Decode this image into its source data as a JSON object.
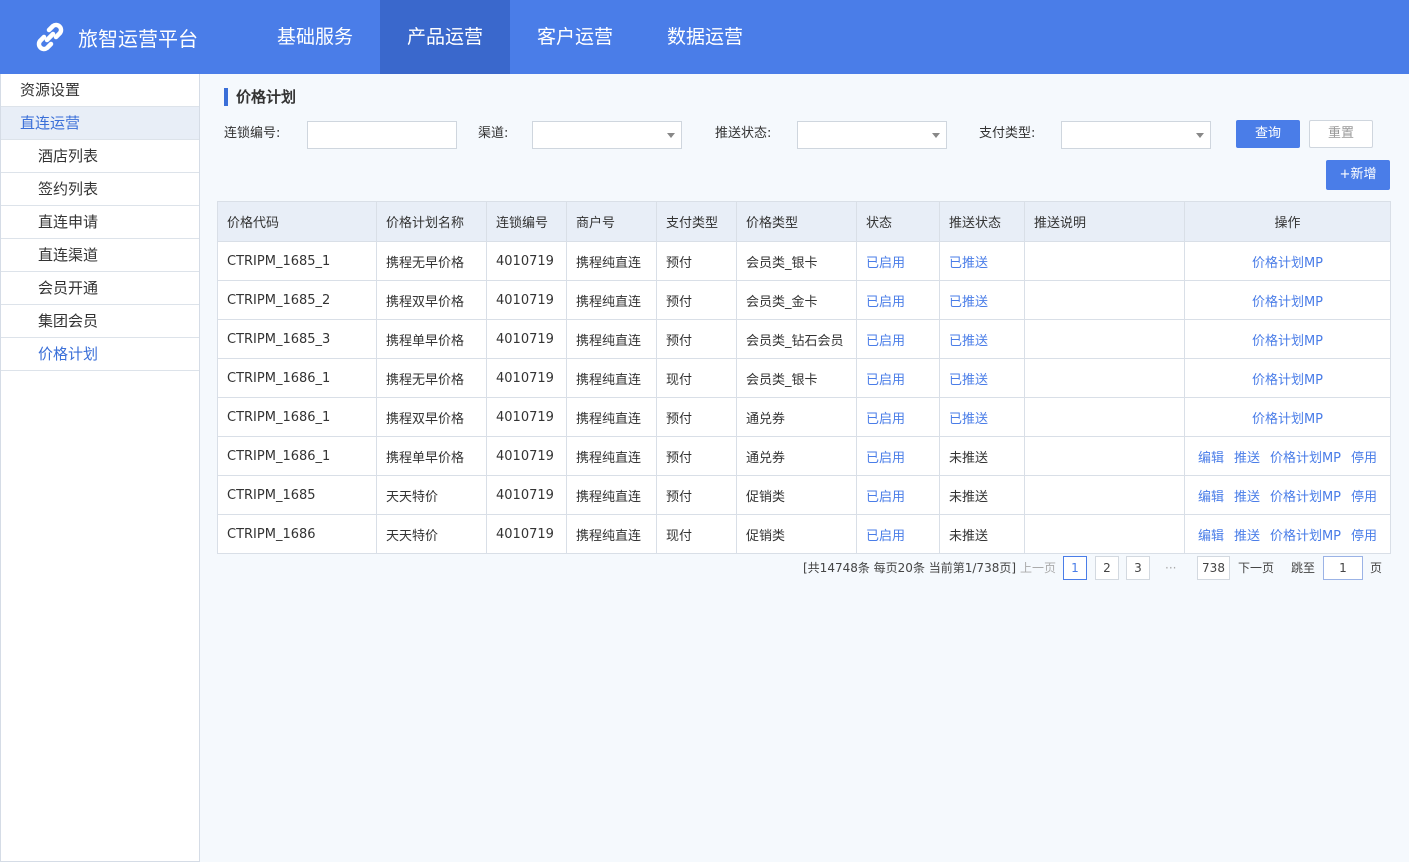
{
  "app": {
    "title": "旅智运营平台",
    "brand_color": "#4a7de8",
    "link_color": "#4a7de8"
  },
  "nav": {
    "items": [
      {
        "label": "基础服务",
        "active": false
      },
      {
        "label": "产品运营",
        "active": true
      },
      {
        "label": "客户运营",
        "active": false
      },
      {
        "label": "数据运营",
        "active": false
      }
    ]
  },
  "sidebar": {
    "items": [
      {
        "label": "资源设置"
      },
      {
        "label": "直连运营"
      },
      {
        "label": "酒店列表"
      },
      {
        "label": "签约列表"
      },
      {
        "label": "直连申请"
      },
      {
        "label": "直连渠道"
      },
      {
        "label": "会员开通"
      },
      {
        "label": "集团会员"
      },
      {
        "label": "价格计划"
      }
    ]
  },
  "page": {
    "title": "价格计划"
  },
  "filters": {
    "chain_no_label": "连锁编号:",
    "chain_no_value": "",
    "channel_label": "渠道:",
    "channel_value": "",
    "push_status_label": "推送状态:",
    "push_status_value": "",
    "pay_type_label": "支付类型:",
    "pay_type_value": "",
    "query_label": "查询",
    "reset_label": "重置",
    "add_label": "+新增"
  },
  "table": {
    "headers": [
      "价格代码",
      "价格计划名称",
      "连锁编号",
      "商户号",
      "支付类型",
      "价格类型",
      "状态",
      "推送状态",
      "推送说明",
      "操作"
    ],
    "rows": [
      {
        "code": "CTRIPM_1685_1",
        "name": "携程无早价格",
        "chain": "4010719",
        "merchant": "携程纯直连",
        "pay": "预付",
        "price_type": "会员类_银卡",
        "status": "已启用",
        "push": "已推送",
        "pushed": true,
        "note": ""
      },
      {
        "code": "CTRIPM_1685_2",
        "name": "携程双早价格",
        "chain": "4010719",
        "merchant": "携程纯直连",
        "pay": "预付",
        "price_type": "会员类_金卡",
        "status": "已启用",
        "push": "已推送",
        "pushed": true,
        "note": ""
      },
      {
        "code": "CTRIPM_1685_3",
        "name": "携程单早价格",
        "chain": "4010719",
        "merchant": "携程纯直连",
        "pay": "预付",
        "price_type": "会员类_钻石会员",
        "status": "已启用",
        "push": "已推送",
        "pushed": true,
        "note": ""
      },
      {
        "code": "CTRIPM_1686_1",
        "name": "携程无早价格",
        "chain": "4010719",
        "merchant": "携程纯直连",
        "pay": "现付",
        "price_type": "会员类_银卡",
        "status": "已启用",
        "push": "已推送",
        "pushed": true,
        "note": ""
      },
      {
        "code": "CTRIPM_1686_1",
        "name": "携程双早价格",
        "chain": "4010719",
        "merchant": "携程纯直连",
        "pay": "预付",
        "price_type": "通兑券",
        "status": "已启用",
        "push": "已推送",
        "pushed": true,
        "note": ""
      },
      {
        "code": "CTRIPM_1686_1",
        "name": "携程单早价格",
        "chain": "4010719",
        "merchant": "携程纯直连",
        "pay": "预付",
        "price_type": "通兑券",
        "status": "已启用",
        "push": "未推送",
        "pushed": false,
        "note": ""
      },
      {
        "code": "CTRIPM_1685",
        "name": "天天特价",
        "chain": "4010719",
        "merchant": "携程纯直连",
        "pay": "预付",
        "price_type": "促销类",
        "status": "已启用",
        "push": "未推送",
        "pushed": false,
        "note": ""
      },
      {
        "code": "CTRIPM_1686",
        "name": "天天特价",
        "chain": "4010719",
        "merchant": "携程纯直连",
        "pay": "现付",
        "price_type": "促销类",
        "status": "已启用",
        "push": "未推送",
        "pushed": false,
        "note": ""
      }
    ],
    "actions": {
      "edit": "编辑",
      "push": "推送",
      "mp": "价格计划MP",
      "disable": "停用"
    }
  },
  "pagination": {
    "summary": "[共14748条 每页20条 当前第1/738页]",
    "prev": "上一页",
    "pages": [
      "1",
      "2",
      "3"
    ],
    "ellipsis": "···",
    "last": "738",
    "next": "下一页",
    "jump_label": "跳至",
    "jump_value": "1",
    "page_suffix": "页"
  }
}
